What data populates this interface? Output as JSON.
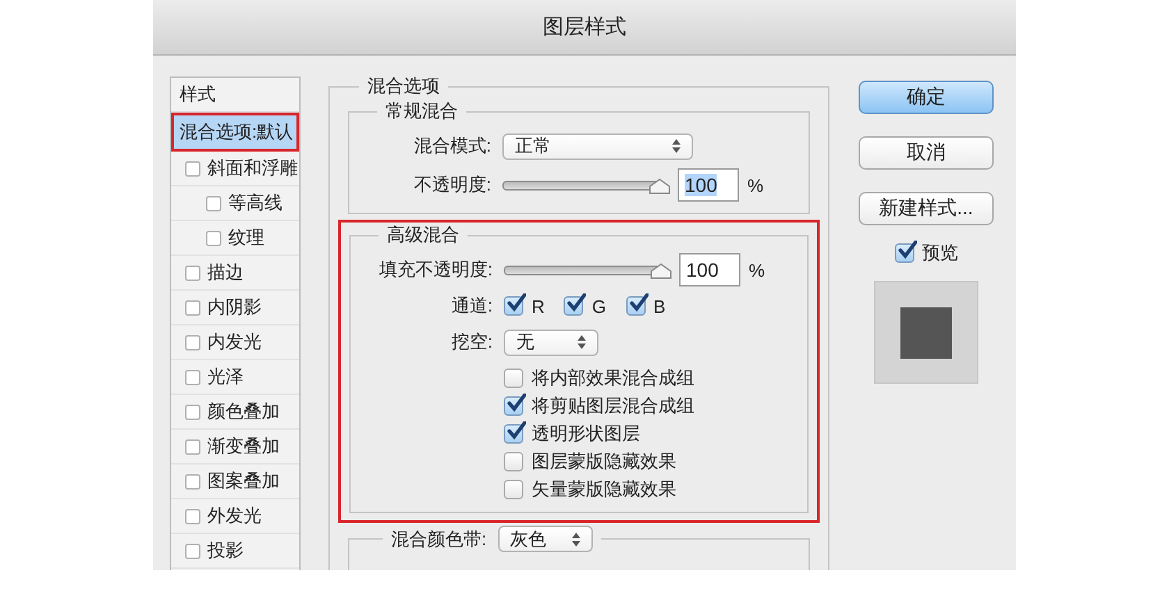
{
  "window": {
    "title": "图层样式"
  },
  "sidebar": {
    "header": "样式",
    "items": [
      {
        "label": "混合选项:默认",
        "kind": "plain",
        "selected": true,
        "highlighted": true
      },
      {
        "label": "斜面和浮雕",
        "kind": "checkbox",
        "checked": false,
        "selected": false,
        "children": [
          {
            "label": "等高线",
            "kind": "checkbox",
            "checked": false,
            "selected": false
          },
          {
            "label": "纹理",
            "kind": "checkbox",
            "checked": false,
            "selected": false
          }
        ]
      },
      {
        "label": "描边",
        "kind": "checkbox",
        "checked": false,
        "selected": false
      },
      {
        "label": "内阴影",
        "kind": "checkbox",
        "checked": false,
        "selected": false
      },
      {
        "label": "内发光",
        "kind": "checkbox",
        "checked": false,
        "selected": false
      },
      {
        "label": "光泽",
        "kind": "checkbox",
        "checked": false,
        "selected": false
      },
      {
        "label": "颜色叠加",
        "kind": "checkbox",
        "checked": false,
        "selected": false
      },
      {
        "label": "渐变叠加",
        "kind": "checkbox",
        "checked": false,
        "selected": false
      },
      {
        "label": "图案叠加",
        "kind": "checkbox",
        "checked": false,
        "selected": false
      },
      {
        "label": "外发光",
        "kind": "checkbox",
        "checked": false,
        "selected": false
      },
      {
        "label": "投影",
        "kind": "checkbox",
        "checked": false,
        "selected": false
      }
    ]
  },
  "blending_options": {
    "title": "混合选项",
    "general": {
      "title": "常规混合",
      "blend_mode": {
        "label": "混合模式:",
        "value": "正常"
      },
      "opacity": {
        "label": "不透明度:",
        "level": 1,
        "value": "100",
        "unit": "%",
        "value_selected": true
      }
    },
    "advanced": {
      "title": "高级混合",
      "highlighted": true,
      "fill_opacity": {
        "label": "填充不透明度:",
        "level": 1,
        "value": "100",
        "unit": "%",
        "value_selected": false
      },
      "channels": {
        "label": "通道:",
        "items": [
          {
            "label": "R",
            "checked": true
          },
          {
            "label": "G",
            "checked": true
          },
          {
            "label": "B",
            "checked": true
          }
        ]
      },
      "knockout": {
        "label": "挖空:",
        "value": "无"
      },
      "options": [
        {
          "label": "将内部效果混合成组",
          "checked": false
        },
        {
          "label": "将剪贴图层混合成组",
          "checked": true
        },
        {
          "label": "透明形状图层",
          "checked": true
        },
        {
          "label": "图层蒙版隐藏效果",
          "checked": false
        },
        {
          "label": "矢量蒙版隐藏效果",
          "checked": false
        }
      ]
    },
    "blend_if": {
      "label": "混合颜色带:",
      "value": "灰色"
    }
  },
  "buttons": [
    {
      "label": "确定",
      "default": true
    },
    {
      "label": "取消",
      "default": false
    },
    {
      "label": "新建样式...",
      "default": false
    }
  ],
  "preview": {
    "label": "预览",
    "checked": true
  }
}
